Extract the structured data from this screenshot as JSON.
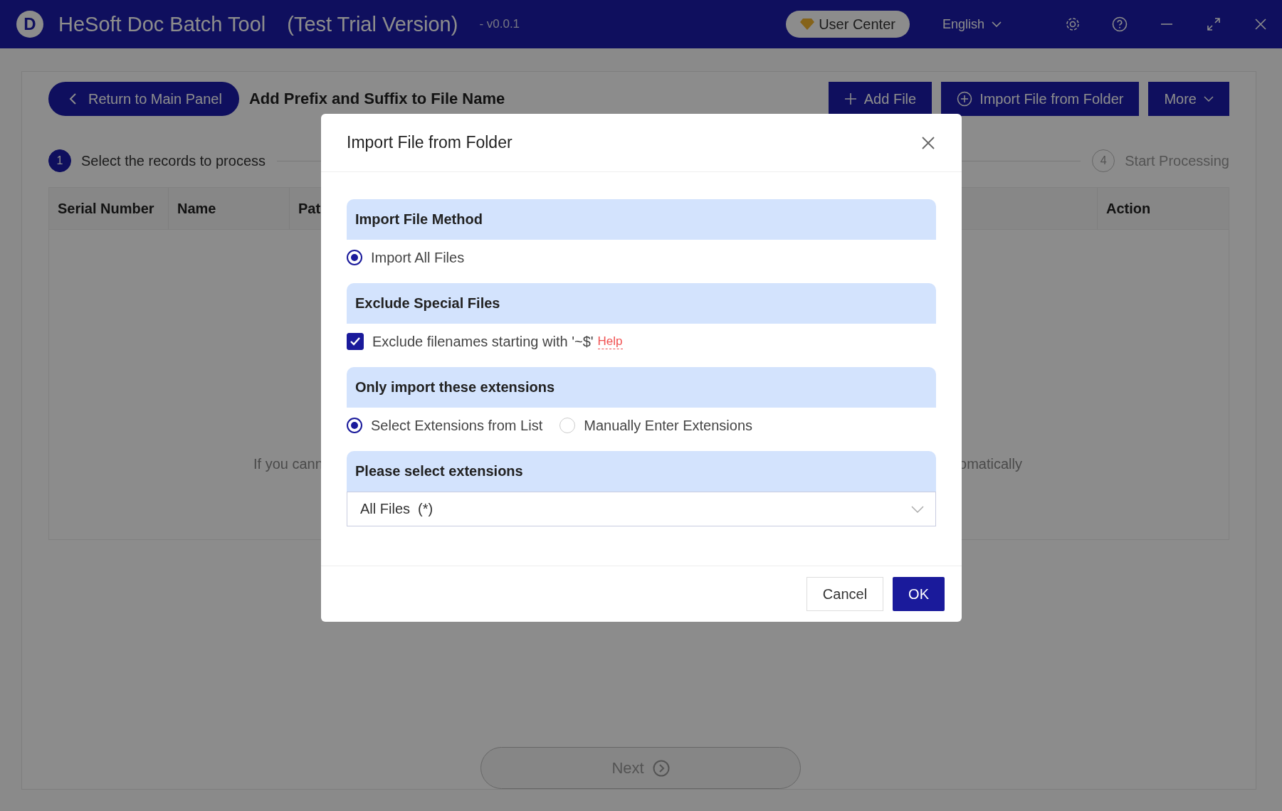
{
  "window": {
    "logo_letter": "D",
    "title": "HeSoft Doc Batch Tool",
    "subtitle": "(Test Trial Version)",
    "version": "- v0.0.1",
    "user_center": "User Center",
    "language": "English"
  },
  "toolbar": {
    "back_button": "Return to Main Panel",
    "page_title": "Add Prefix and Suffix to File Name",
    "buttons": [
      {
        "label": "Add File",
        "kind": "plus"
      },
      {
        "label": "Import File from Folder",
        "kind": "plus-circle"
      },
      {
        "label": "More",
        "kind": "caret"
      }
    ]
  },
  "steps": [
    {
      "number": "1",
      "label": "Select the records to process",
      "selected": true
    },
    {
      "number": "4",
      "label": "Start Processing",
      "selected": false
    }
  ],
  "table": {
    "columns": [
      "Serial Number",
      "Name",
      "Pat",
      "Action"
    ],
    "empty_text_left": "If you cann",
    "empty_text_right": "omatically"
  },
  "next_button": "Next",
  "dialog": {
    "title": "Import File from Folder",
    "sections": [
      {
        "heading": "Import File Method",
        "kind": "radio",
        "options": [
          {
            "label": "Import All Files",
            "selected": true
          }
        ]
      },
      {
        "heading": "Exclude Special Files",
        "kind": "checkbox",
        "options": [
          {
            "label": "Exclude filenames starting with '~$'",
            "checked": true,
            "link": "Help"
          }
        ]
      },
      {
        "heading": "Only import these extensions",
        "kind": "radio",
        "options": [
          {
            "label": "Select Extensions from List",
            "selected": true
          },
          {
            "label": "Manually Enter Extensions",
            "selected": false
          }
        ]
      },
      {
        "heading": "Please select extensions",
        "kind": "select",
        "value": "All Files  (*)"
      }
    ],
    "cancel": "Cancel",
    "ok": "OK"
  }
}
